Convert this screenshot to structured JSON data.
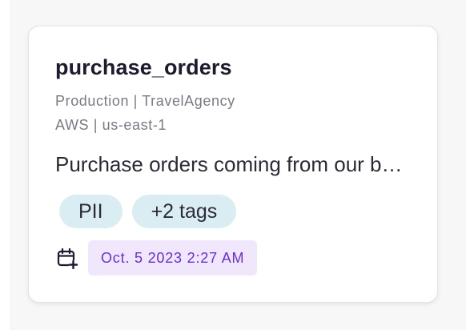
{
  "card": {
    "title": "purchase_orders",
    "environment_line": "Production | TravelAgency",
    "provider_line": "AWS | us-east-1",
    "description": "Purchase orders coming from our booking system and partner channels",
    "tags": [
      "PII",
      "+2 tags"
    ],
    "date": "Oct. 5 2023 2:27 AM",
    "date_icon": "calendar-add-icon"
  },
  "colors": {
    "tag_bg": "#d9edf3",
    "date_bg": "#f0e7fd",
    "date_text": "#6b2fd6",
    "title_text": "#1d1c2e",
    "meta_text": "#7a7a86"
  }
}
